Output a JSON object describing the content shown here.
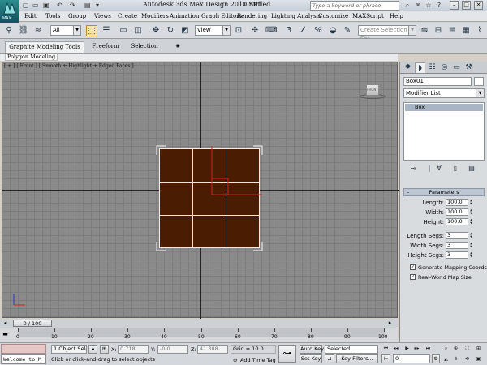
{
  "window": {
    "app_title": "Autodesk 3ds Max Design 2010 SP1",
    "file_name": "Untitled",
    "search_placeholder": "Type a keyword or phrase",
    "logo_label": "MAX"
  },
  "menus": [
    "Edit",
    "Tools",
    "Group",
    "Views",
    "Create",
    "Modifiers",
    "Animation",
    "Graph Editors",
    "Rendering",
    "Lighting Analysis",
    "Customize",
    "MAXScript",
    "Help"
  ],
  "toolbar": {
    "filter_value": "All",
    "reference_coord_value": "View",
    "selection_set_placeholder": "Create Selection Set"
  },
  "ribbon": {
    "tabs": [
      "Graphite Modeling Tools",
      "Freeform",
      "Selection"
    ],
    "subtab": "Polygon Modeling"
  },
  "viewport": {
    "label": "[ + ] [ Front ] [ Smooth + Highlight + Edged Faces ]",
    "viewcube_label": "FRONT",
    "object_color": "#4a1d02"
  },
  "time": {
    "slider_label": "0 / 100",
    "ticks": [
      "0",
      "10",
      "20",
      "30",
      "40",
      "50",
      "60",
      "70",
      "80",
      "90",
      "100"
    ]
  },
  "status": {
    "welcome": "Welcome to M",
    "selection": "1 Object Sele",
    "x_label": "X:",
    "x_value": "0.718",
    "y_label": "Y:",
    "y_value": "-0.0",
    "z_label": "Z:",
    "z_value": "41.388",
    "grid": "Grid = 10.0",
    "prompt": "Click or click-and-drag to select objects",
    "add_time_tag": "Add Time Tag",
    "auto_key": "Auto Key",
    "set_key": "Set Key",
    "key_mode_value": "Selected",
    "key_filters": "Key Filters...",
    "frame_value": "0"
  },
  "command_panel": {
    "object_name": "Box01",
    "modifier_list": "Modifier List",
    "stack_item": "Box",
    "rollout_title": "Parameters",
    "params": [
      {
        "label": "Length:",
        "value": "100.0"
      },
      {
        "label": "Width:",
        "value": "100.0"
      },
      {
        "label": "Height:",
        "value": "100.0"
      }
    ],
    "segs": [
      {
        "label": "Length Segs:",
        "value": "3"
      },
      {
        "label": "Width Segs:",
        "value": "3"
      },
      {
        "label": "Height Segs:",
        "value": "3"
      }
    ],
    "checkboxes": [
      {
        "label": "Generate Mapping Coords.",
        "checked": true
      },
      {
        "label": "Real-World Map Size",
        "checked": true
      }
    ]
  }
}
